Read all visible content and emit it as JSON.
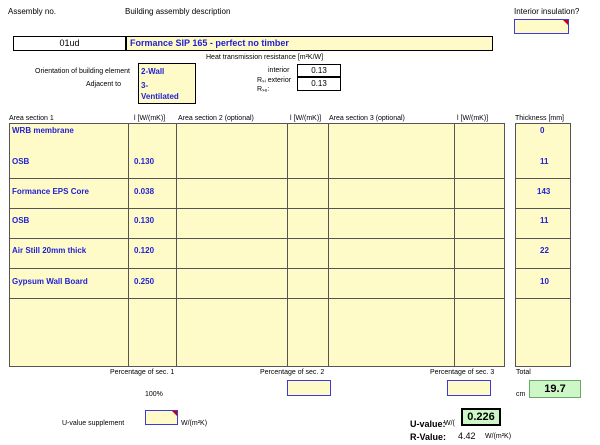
{
  "header": {
    "assembly_no_label": "Assembly no.",
    "description_label": "Building assembly description",
    "interior_insulation_label": "Interior insulation?",
    "assembly_no": "01ud",
    "description": "Formance SIP 165 - perfect no timber"
  },
  "resistance": {
    "title": "Heat transmission resistance  [m²K/W]",
    "interior_label": "interior",
    "exterior_label": "Rₛᵢ exterior",
    "rse_label": "Rₛₑ:",
    "interior_value": "0.13",
    "exterior_value": "0.13"
  },
  "orientation": {
    "label": "Orientation of building element",
    "value": "2-Wall",
    "adjacent_label": "Adjacent to",
    "adjacent_value": "3-Ventilated"
  },
  "columns": {
    "area1": "Area section 1",
    "lambda1": "l [W/(mK)]",
    "area2": "Area section 2 (optional)",
    "lambda2": "l [W/(mK)]",
    "area3": "Area section 3 (optional)",
    "lambda3": "l [W/(mK)]",
    "thickness": "Thickness [mm]"
  },
  "layers": [
    {
      "name": "WRB membrane",
      "lambda": "",
      "thickness": "0"
    },
    {
      "name": "OSB",
      "lambda": "0.130",
      "thickness": "11"
    },
    {
      "name": "Formance EPS Core",
      "lambda": "0.038",
      "thickness": "143"
    },
    {
      "name": "OSB",
      "lambda": "0.130",
      "thickness": "11"
    },
    {
      "name": "Air Still 20mm thick",
      "lambda": "0.120",
      "thickness": "22"
    },
    {
      "name": "Gypsum Wall Board",
      "lambda": "0.250",
      "thickness": "10"
    }
  ],
  "percentages": {
    "sec1_label": "Percentage of sec. 1",
    "sec2_label": "Percentage of sec. 2",
    "sec3_label": "Percentage of sec. 3",
    "sec1_value": "100%",
    "total_label": "Total",
    "total_unit": "cm",
    "total_value": "19.7"
  },
  "results": {
    "supplement_label": "U-value supplement",
    "supplement_unit": "W/(m²K)",
    "u_label": "U-value:",
    "u_unit_prefix": "W/(",
    "u_value": "0.226",
    "r_label": "R-Value:",
    "r_value": "4.42",
    "r_unit": "W/(m²K)"
  }
}
